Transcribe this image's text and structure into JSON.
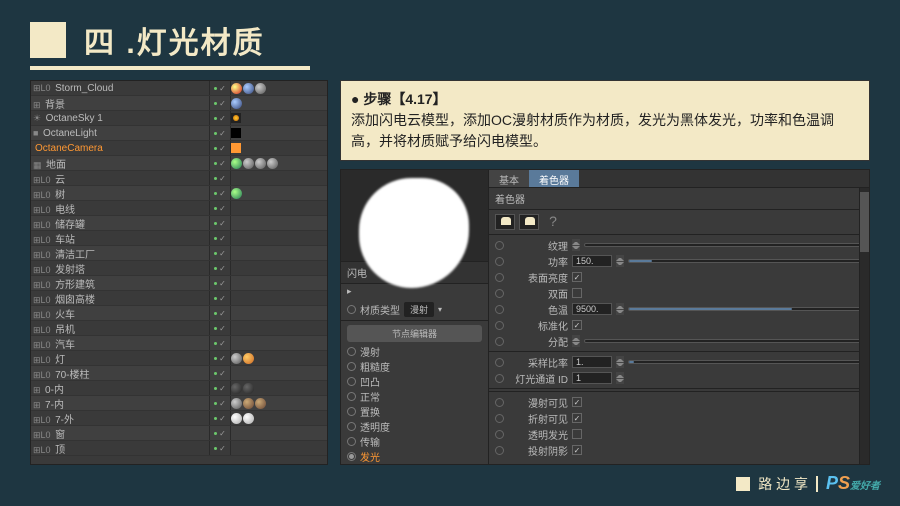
{
  "title": "四 .灯光材质",
  "instruction": {
    "step": "● 步骤【4.17】",
    "body": "添加闪电云模型，添加OC漫射材质作为材质，发光为黑体发光，功率和色温调高，并将材质赋予给闪电模型。"
  },
  "tree": [
    {
      "name": "Storm_Cloud",
      "prefix": "⊞L0 ",
      "balls": [
        "red",
        "blue",
        "grey"
      ]
    },
    {
      "name": "背景",
      "prefix": "  ⊞ ",
      "balls": [
        "blue"
      ]
    },
    {
      "name": "OctaneSky 1",
      "prefix": "  ☀ ",
      "sq": "sun"
    },
    {
      "name": "OctaneLight",
      "prefix": "  ■ ",
      "sq": "black"
    },
    {
      "name": "OctaneCamera",
      "prefix": "  ",
      "sel": true,
      "sq": "orange"
    },
    {
      "name": "地面",
      "prefix": "▦ ",
      "balls": [
        "green",
        "grey",
        "grey",
        "grey"
      ]
    },
    {
      "name": "云",
      "prefix": "⊞L0 "
    },
    {
      "name": "树",
      "prefix": "⊞L0 ",
      "balls": [
        "green"
      ]
    },
    {
      "name": "电线",
      "prefix": "⊞L0 "
    },
    {
      "name": "储存罐",
      "prefix": "⊞L0 "
    },
    {
      "name": "车站",
      "prefix": "⊞L0 "
    },
    {
      "name": "清洁工厂",
      "prefix": "⊞L0 "
    },
    {
      "name": "发射塔",
      "prefix": "⊞L0 "
    },
    {
      "name": "方形建筑",
      "prefix": "⊞L0 "
    },
    {
      "name": "烟囱高楼",
      "prefix": "⊞L0 "
    },
    {
      "name": "火车",
      "prefix": "⊞L0 "
    },
    {
      "name": "吊机",
      "prefix": "⊞L0 "
    },
    {
      "name": "汽车",
      "prefix": "⊞L0 "
    },
    {
      "name": "灯",
      "prefix": "⊞L0 ",
      "balls": [
        "grey",
        "orange"
      ]
    },
    {
      "name": "70-楼柱",
      "prefix": "⊞L0 "
    },
    {
      "name": "0-内",
      "prefix": "⊞ ",
      "balls": [
        "dark",
        "dark"
      ]
    },
    {
      "name": "7-内",
      "prefix": "⊞ ",
      "balls": [
        "grey",
        "brown",
        "brown"
      ]
    },
    {
      "name": "7-外",
      "prefix": "⊞L0 ",
      "balls": [
        "white",
        "white"
      ]
    },
    {
      "name": "窗",
      "prefix": "⊞L0 "
    },
    {
      "name": "顶",
      "prefix": "⊞L0 "
    }
  ],
  "material": {
    "name": "闪电",
    "type_label": "材质类型",
    "type_value": "漫射",
    "node_editor": "节点编辑器",
    "props": [
      "漫射",
      "粗糙度",
      "凹凸",
      "正常",
      "置换",
      "透明度",
      "传输",
      "发光"
    ],
    "tabs": [
      "基本",
      "着色器"
    ],
    "shader_header": "着色器",
    "params": [
      {
        "label": "纹理",
        "kind": "slot"
      },
      {
        "label": "功率",
        "kind": "numslider",
        "value": "150.",
        "fill": 10
      },
      {
        "label": "表面亮度",
        "kind": "check",
        "checked": true
      },
      {
        "label": "双面",
        "kind": "check",
        "checked": false
      },
      {
        "label": "色温",
        "kind": "numslider",
        "value": "9500.",
        "fill": 70
      },
      {
        "label": "标准化",
        "kind": "check",
        "checked": true
      },
      {
        "label": "分配",
        "kind": "slot"
      },
      {
        "label": "采样比率",
        "kind": "numslider",
        "value": "1.",
        "fill": 2
      },
      {
        "label": "灯光通道 ID",
        "kind": "num",
        "value": "1"
      },
      {
        "label": "漫射可见",
        "kind": "check",
        "checked": true
      },
      {
        "label": "折射可见",
        "kind": "check",
        "checked": true
      },
      {
        "label": "透明发光",
        "kind": "check",
        "checked": false
      },
      {
        "label": "投射阴影",
        "kind": "check",
        "checked": true
      }
    ]
  },
  "footer": {
    "author": "路 边 享",
    "brand_p": "P",
    "brand_s": "S",
    "brand_sub": "爱好者"
  }
}
